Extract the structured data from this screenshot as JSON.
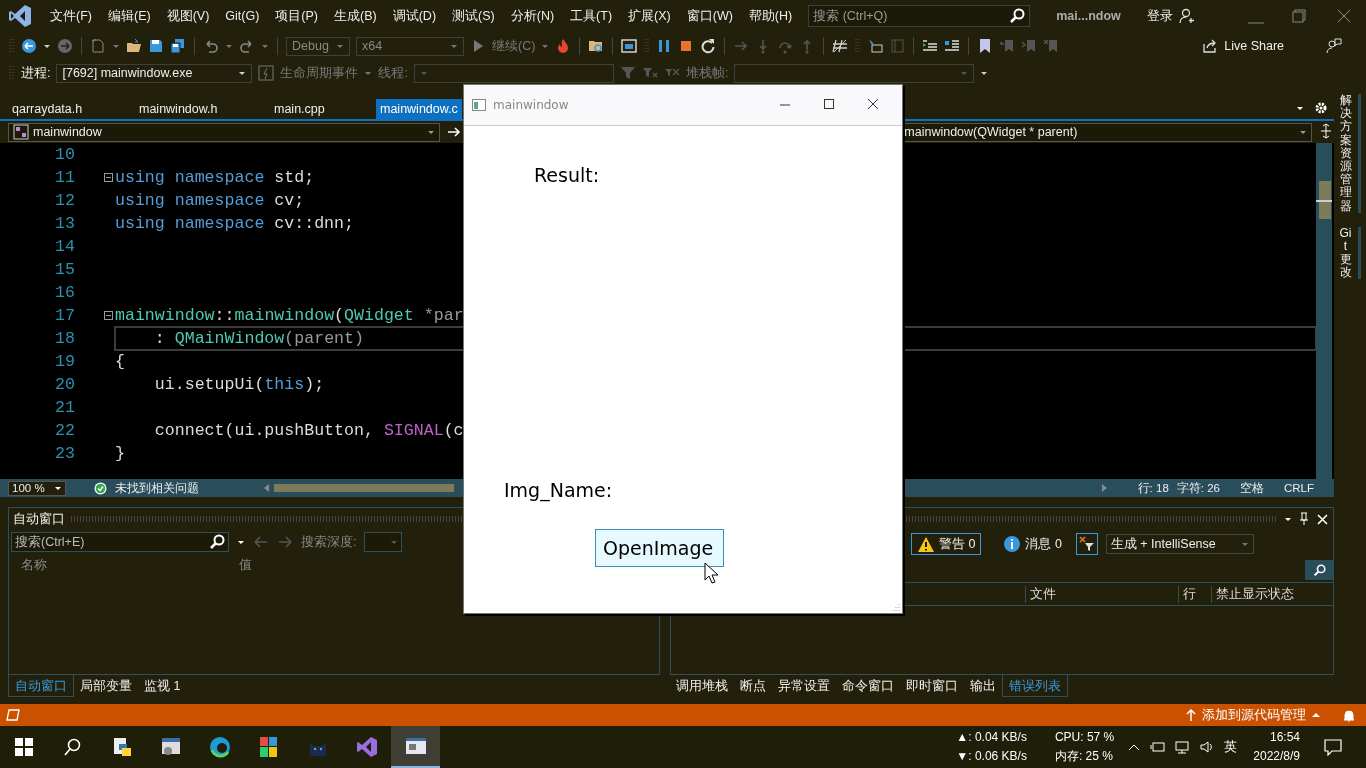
{
  "ide": {
    "menu": [
      "文件(F)",
      "编辑(E)",
      "视图(V)",
      "Git(G)",
      "项目(P)",
      "生成(B)",
      "调试(D)",
      "测试(S)",
      "分析(N)",
      "工具(T)",
      "扩展(X)",
      "窗口(W)",
      "帮助(H)"
    ],
    "search_placeholder": "搜索 (Ctrl+Q)",
    "title": "mai...ndow",
    "login": "登录",
    "toolbar": {
      "configuration": "Debug",
      "platform": "x64",
      "continue": "继续(C)",
      "live_share": "Live Share"
    },
    "debug_bar": {
      "process_label": "进程:",
      "process": "[7692] mainwindow.exe",
      "lifecycle": "生命周期事件",
      "thread_label": "线程:",
      "stack_label": "堆栈帧:"
    },
    "doc_tabs": [
      {
        "label": "qarraydata.h",
        "selected": false
      },
      {
        "label": "mainwindow.h",
        "selected": false
      },
      {
        "label": "main.cpp",
        "selected": false
      },
      {
        "label": "mainwindow.c",
        "selected": true
      }
    ],
    "nav": {
      "scope": "mainwindow",
      "member": "mainwindow(QWidget * parent)"
    },
    "code_lines": [
      {
        "number": "10",
        "fold": false,
        "current": false
      },
      {
        "number": "11",
        "fold": true,
        "current": false,
        "tokens": [
          {
            "text": "using namespace",
            "kind": "keyword"
          },
          {
            "text": " std;",
            "kind": "plain"
          }
        ]
      },
      {
        "number": "12",
        "fold": false,
        "current": false,
        "tokens": [
          {
            "text": "using namespace",
            "kind": "keyword"
          },
          {
            "text": " cv;",
            "kind": "plain"
          }
        ]
      },
      {
        "number": "13",
        "fold": false,
        "current": false,
        "tokens": [
          {
            "text": "using namespace",
            "kind": "keyword"
          },
          {
            "text": " cv::dnn;",
            "kind": "plain"
          }
        ]
      },
      {
        "number": "14",
        "fold": false,
        "current": false
      },
      {
        "number": "15",
        "fold": false,
        "current": false
      },
      {
        "number": "16",
        "fold": false,
        "current": false
      },
      {
        "number": "17",
        "fold": true,
        "current": false,
        "tokens": [
          {
            "text": "mainwindow",
            "kind": "type"
          },
          {
            "text": "::",
            "kind": "plain"
          },
          {
            "text": "mainwindow",
            "kind": "type"
          },
          {
            "text": "(",
            "kind": "plain"
          },
          {
            "text": "QWidget",
            "kind": "type"
          },
          {
            "text": " *par",
            "kind": "param"
          }
        ]
      },
      {
        "number": "18",
        "fold": false,
        "current": true,
        "tokens": [
          {
            "text": "    : ",
            "kind": "plain"
          },
          {
            "text": "QMainWindow",
            "kind": "type"
          },
          {
            "text": "(parent)",
            "kind": "param"
          }
        ]
      },
      {
        "number": "19",
        "fold": false,
        "current": false,
        "tokens": [
          {
            "text": "{",
            "kind": "plain"
          }
        ]
      },
      {
        "number": "20",
        "fold": false,
        "current": false,
        "tokens": [
          {
            "text": "    ui.setupUi(",
            "kind": "plain"
          },
          {
            "text": "this",
            "kind": "keyword"
          },
          {
            "text": ");",
            "kind": "plain"
          }
        ]
      },
      {
        "number": "21",
        "fold": false,
        "current": false
      },
      {
        "number": "22",
        "fold": false,
        "current": false,
        "tokens": [
          {
            "text": "    connect(ui.pushButton, ",
            "kind": "plain"
          },
          {
            "text": "SIGNAL",
            "kind": "macro"
          },
          {
            "text": "(c",
            "kind": "plain"
          }
        ]
      },
      {
        "number": "23",
        "fold": false,
        "current": false,
        "tokens": [
          {
            "text": "}",
            "kind": "plain"
          }
        ]
      }
    ],
    "editor_status": {
      "zoom": "100 %",
      "issues": "未找到相关问题",
      "line": "行: 18",
      "char": "字符: 26",
      "indent": "空格",
      "eol": "CRLF"
    },
    "autos": {
      "title": "自动窗口",
      "search_placeholder": "搜索(Ctrl+E)",
      "depth_label": "搜索深度:",
      "columns": [
        "名称",
        "值"
      ]
    },
    "error_list": {
      "warnings": "警告 0",
      "messages": "消息 0",
      "scope": "生成 + IntelliSense",
      "columns": [
        "文件",
        "行",
        "禁止显示状态"
      ]
    },
    "left_tabs": [
      {
        "label": "自动窗口",
        "selected": true
      },
      {
        "label": "局部变量",
        "selected": false
      },
      {
        "label": "监视 1",
        "selected": false
      }
    ],
    "right_tabs": [
      {
        "label": "调用堆栈",
        "selected": false
      },
      {
        "label": "断点",
        "selected": false
      },
      {
        "label": "异常设置",
        "selected": false
      },
      {
        "label": "命令窗口",
        "selected": false
      },
      {
        "label": "即时窗口",
        "selected": false
      },
      {
        "label": "输出",
        "selected": false
      },
      {
        "label": "错误列表",
        "selected": true
      }
    ],
    "side_tabs": [
      "解决方案资源管理器",
      "Git 更改"
    ],
    "status": {
      "source_control": "添加到源代码管理"
    }
  },
  "taskbar": {
    "net_up": "▲: 0.04 KB/s",
    "net_down": "▼: 0.06 KB/s",
    "cpu": "CPU: 57 %",
    "memory": "内存: 25 %",
    "ime": "英",
    "time": "16:54",
    "date": "2022/8/9"
  },
  "app_window": {
    "title": "mainwindow",
    "result_label": "Result:",
    "name_label": "Img_Name:",
    "button": "OpenImage"
  }
}
